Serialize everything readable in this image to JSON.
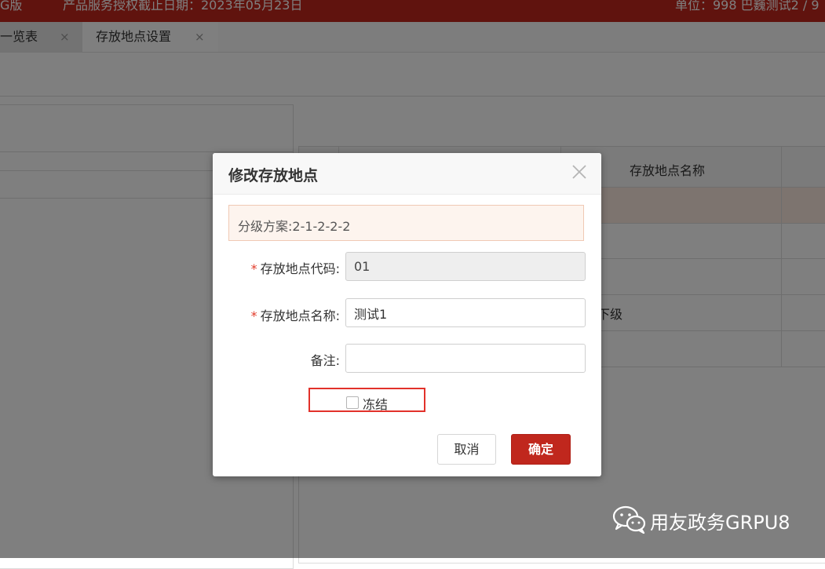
{
  "topbar": {
    "version_fragment": "G版",
    "license_notice": "产品服务授权截止日期：2023年05月23日",
    "unit_info": "单位：998 巴巍测试2 / 9"
  },
  "tabs": [
    {
      "label": "一览表",
      "close": "×"
    },
    {
      "label": "存放地点设置",
      "close": "×"
    }
  ],
  "grid": {
    "header": "存放地点名称",
    "row_fragment": "下级"
  },
  "dialog": {
    "title": "修改存放地点",
    "notice": "分级方案:2-1-2-2-2",
    "fields": {
      "code": {
        "required_mark": "*",
        "label": "存放地点代码:",
        "value": "01"
      },
      "name": {
        "required_mark": "*",
        "label": "存放地点名称:",
        "value": "测试1"
      },
      "remark": {
        "label": "备注:",
        "value": ""
      }
    },
    "freeze": {
      "label": "冻结",
      "checked": false
    },
    "buttons": {
      "cancel": "取消",
      "confirm": "确定"
    }
  },
  "watermark": {
    "text": "用友政务GRPU8",
    "icon": "wechat-icon"
  },
  "colors": {
    "brand": "#c0271d",
    "required": "#e23b2a",
    "highlight_border": "#e2312a",
    "notice_bg": "#fdf4ee"
  }
}
